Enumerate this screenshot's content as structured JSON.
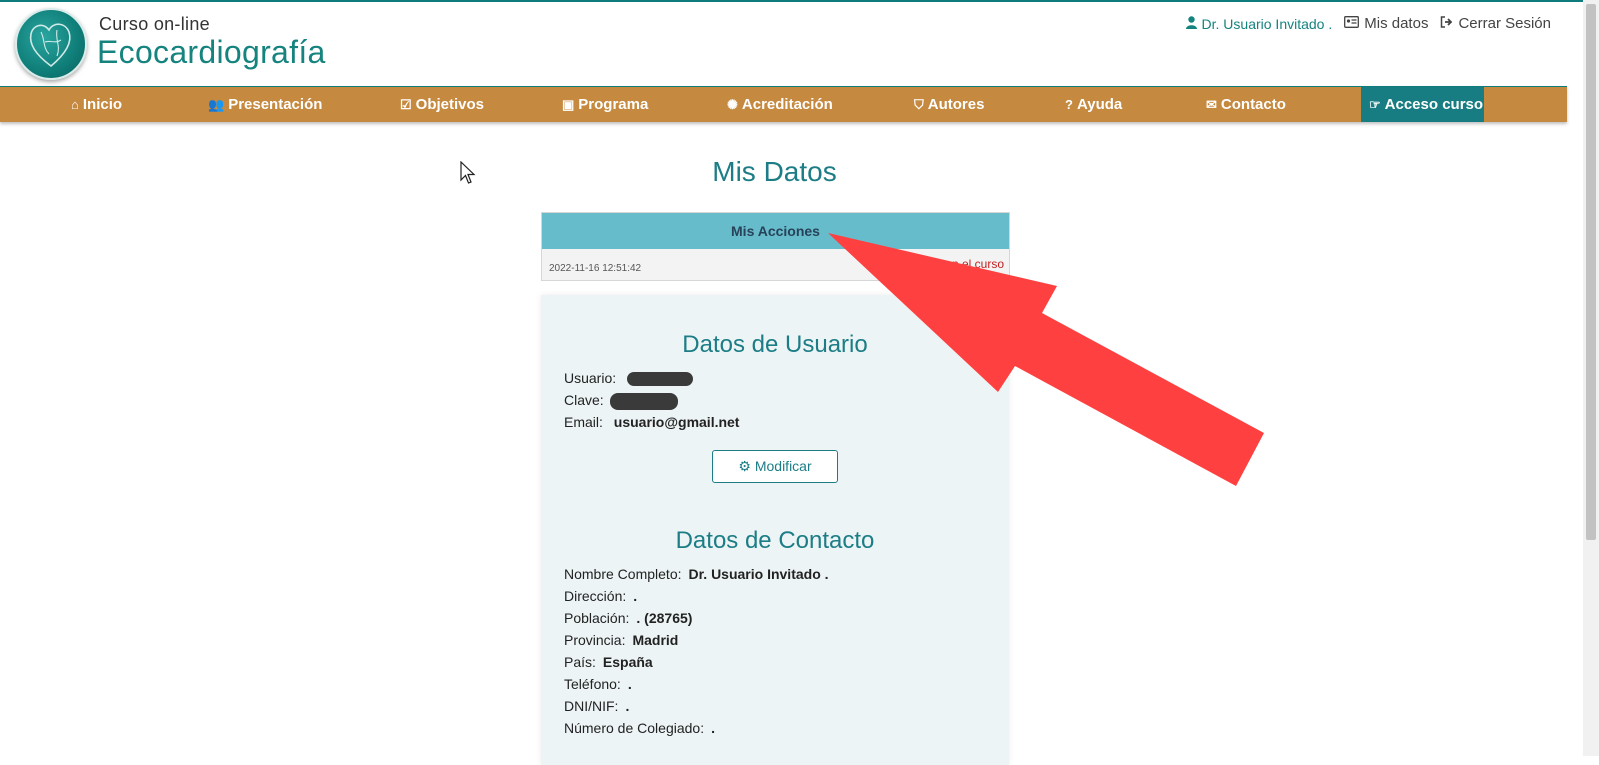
{
  "header": {
    "brand_small": "Curso  on-line",
    "brand_big": "Ecocardiografía",
    "user_name": "Dr. Usuario Invitado .",
    "my_data_link": "Mis datos",
    "logout_link": "Cerrar Sesión"
  },
  "nav": {
    "items": [
      {
        "label": "Inicio",
        "icon": "home-icon"
      },
      {
        "label": "Presentación",
        "icon": "users-icon"
      },
      {
        "label": "Objetivos",
        "icon": "check-square-icon"
      },
      {
        "label": "Programa",
        "icon": "calendar-check-icon"
      },
      {
        "label": "Acreditación",
        "icon": "badge-icon"
      },
      {
        "label": "Autores",
        "icon": "shield-icon"
      },
      {
        "label": "Ayuda",
        "icon": "question-circle-icon"
      },
      {
        "label": "Contacto",
        "icon": "envelope-icon"
      },
      {
        "label": "Acceso curso",
        "icon": "hand-pointer-icon"
      }
    ],
    "colors": {
      "bar": "#c5893f",
      "active": "#177d83"
    }
  },
  "main": {
    "title": "Mis Datos",
    "actions": {
      "header": "Mis Acciones",
      "rows": [
        {
          "date": "2022-11-16 12:51:42",
          "action": "Registro en el curso"
        }
      ]
    },
    "user_section": {
      "title": "Datos de Usuario",
      "usuario_label": "Usuario:",
      "clave_label": "Clave:",
      "email_label": "Email:",
      "email_value": "usuario@gmail.net",
      "modify_button": "Modificar"
    },
    "contact_section": {
      "title": "Datos de Contacto",
      "fields": [
        {
          "label": "Nombre Completo:",
          "value": "Dr. Usuario Invitado ."
        },
        {
          "label": "Dirección:",
          "value": "."
        },
        {
          "label": "Población:",
          "value": ". (28765)"
        },
        {
          "label": "Provincia:",
          "value": "Madrid"
        },
        {
          "label": "País:",
          "value": "España"
        },
        {
          "label": "Teléfono:",
          "value": "."
        },
        {
          "label": "DNI/NIF:",
          "value": "."
        },
        {
          "label": "Número de Colegiado:",
          "value": "."
        }
      ]
    }
  },
  "colors": {
    "accent": "#1c7d86",
    "annotation_arrow": "#ff4040"
  }
}
